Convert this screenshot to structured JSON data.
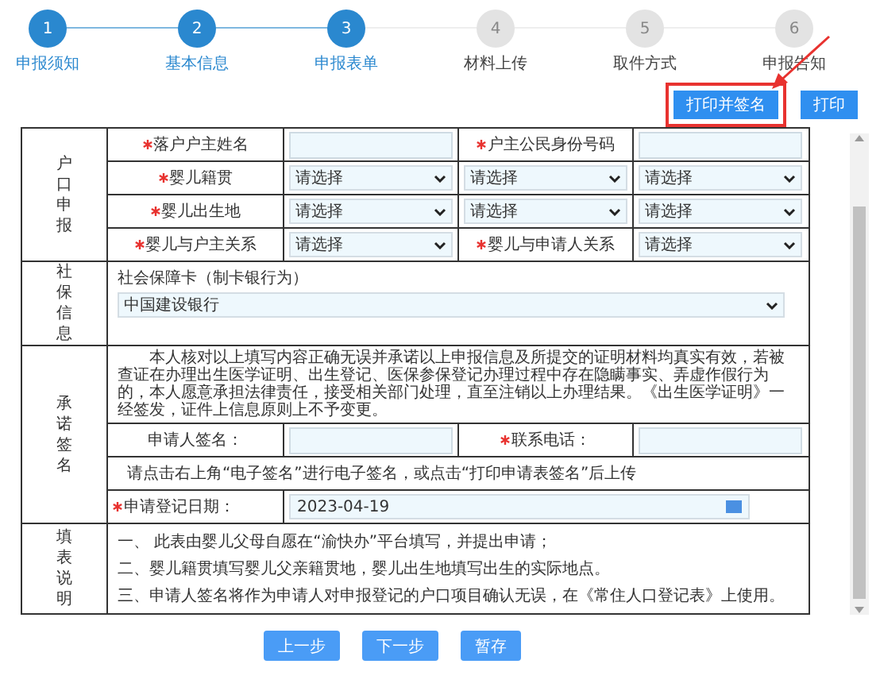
{
  "steps": [
    {
      "number": "1",
      "label": "申报须知",
      "completed": true
    },
    {
      "number": "2",
      "label": "基本信息",
      "completed": true
    },
    {
      "number": "3",
      "label": "申报表单",
      "completed": true
    },
    {
      "number": "4",
      "label": "材料上传",
      "completed": false
    },
    {
      "number": "5",
      "label": "取件方式",
      "completed": false
    },
    {
      "number": "6",
      "label": "申报告知",
      "completed": false
    }
  ],
  "toolbar": {
    "buttons": [
      {
        "label": "打印并签名",
        "highlighted": true
      },
      {
        "label": "打印",
        "highlighted": false
      }
    ]
  },
  "form": {
    "sections": [
      {
        "kind": "grid",
        "title": "户口申报",
        "rows": [
          [
            {
              "kind": "label",
              "text": "落户户主姓名",
              "required": true
            },
            {
              "kind": "input"
            },
            {
              "kind": "label",
              "text": "户主公民身份号码",
              "required": true
            },
            {
              "kind": "input"
            }
          ],
          [
            {
              "kind": "label",
              "text": "婴儿籍贯",
              "required": true
            },
            {
              "kind": "select",
              "value": "请选择"
            },
            {
              "kind": "select",
              "value": "请选择"
            },
            {
              "kind": "select",
              "value": "请选择"
            }
          ],
          [
            {
              "kind": "label",
              "text": "婴儿出生地",
              "required": true
            },
            {
              "kind": "select",
              "value": "请选择"
            },
            {
              "kind": "select",
              "value": "请选择"
            },
            {
              "kind": "select",
              "value": "请选择"
            }
          ],
          [
            {
              "kind": "label",
              "text": "婴儿与户主关系",
              "required": true
            },
            {
              "kind": "select",
              "value": "请选择"
            },
            {
              "kind": "label",
              "text": "婴儿与申请人关系",
              "required": true
            },
            {
              "kind": "select",
              "value": "请选择"
            }
          ]
        ]
      },
      {
        "kind": "social",
        "title": "社保信息",
        "label": "社会保障卡（制卡银行为）",
        "value": "中国建设银行"
      },
      {
        "kind": "grid",
        "title": "承诺签名",
        "rows": [
          [
            {
              "kind": "paragraph",
              "text": "本人核对以上填写内容正确无误并承诺以上申报信息及所提交的证明材料均真实有效，若被查证在办理出生医学证明、出生登记、医保参保登记办理过程中存在隐瞒事实、弄虚作假行为的，本人愿意承担法律责任，接受相关部门处理，直至注销以上办理结果。《出生医学证明》一经签发，证件上信息原则上不予变更。"
            }
          ],
          [
            {
              "kind": "label",
              "text": "申请人签名：",
              "required": false
            },
            {
              "kind": "input"
            },
            {
              "kind": "label",
              "text": "联系电话：",
              "required": true
            },
            {
              "kind": "input"
            }
          ],
          [
            {
              "kind": "notice",
              "text": "请点击右上角“电子签名”进行电子签名，或点击“打印申请表签名”后上传"
            }
          ],
          [
            {
              "kind": "label",
              "text": "申请登记日期：",
              "required": true
            },
            {
              "kind": "date",
              "value": "2023-04-19"
            }
          ]
        ]
      },
      {
        "kind": "notes",
        "title": "填表说明",
        "lines": [
          "一、 此表由婴儿父母自愿在“渝快办”平台填写，并提出申请；",
          "二、婴儿籍贯填写婴儿父亲籍贯地，婴儿出生地填写出生的实际地点。",
          "三、申请人签名将作为申请人对申报登记的户口项目确认无误，在《常住人口登记表》上使用。"
        ]
      }
    ]
  },
  "actions": [
    "上一步",
    "下一步",
    "暂存"
  ]
}
